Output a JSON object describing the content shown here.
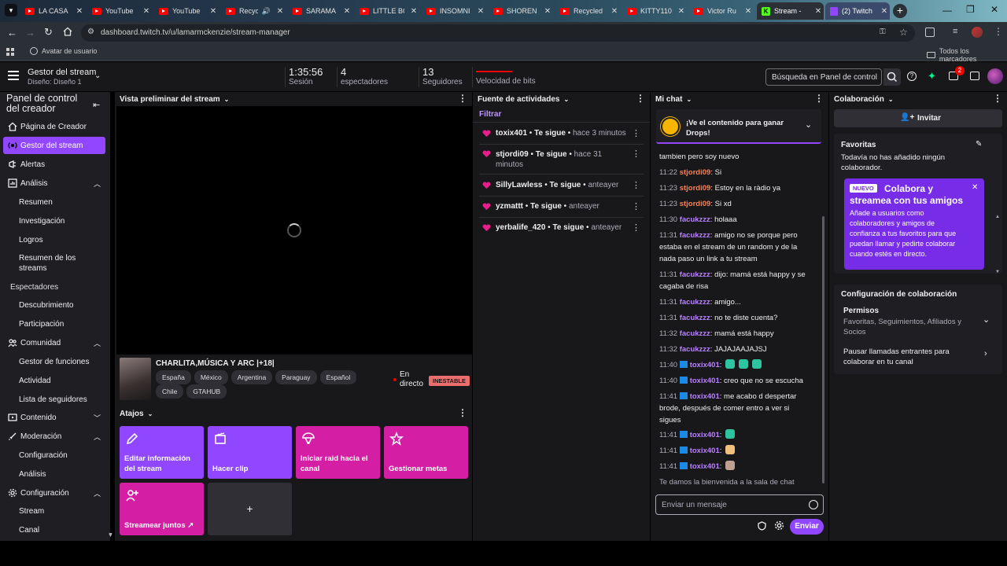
{
  "browser": {
    "tabs": [
      {
        "label": "LA CASA D"
      },
      {
        "label": "YouTube"
      },
      {
        "label": "YouTube"
      },
      {
        "label": "Recycl"
      },
      {
        "label": "SARAMA"
      },
      {
        "label": "LITTLE BO"
      },
      {
        "label": "INSOMNI"
      },
      {
        "label": "SHOREN"
      },
      {
        "label": "Recycled"
      },
      {
        "label": "KITTY110"
      },
      {
        "label": "Victor Ru"
      },
      {
        "label": "Stream - "
      },
      {
        "label": "(2) Twitch"
      }
    ],
    "url": "dashboard.twitch.tv/u/lamarmckenzie/stream-manager",
    "bookmark_left": "Avatar de usuario",
    "bookmark_right": "Todos los marcadores"
  },
  "topnav": {
    "title": "Gestor del stream",
    "subtitle": "Diseño: Diseño 1",
    "stats": [
      {
        "value": "1:35:56",
        "label": "Sesión"
      },
      {
        "value": "4",
        "label": "espectadores"
      },
      {
        "value": "13",
        "label": "Seguidores"
      },
      {
        "value": "",
        "label": "Velocidad de bits"
      }
    ],
    "search_placeholder": "Búsqueda en Panel de control",
    "notif_count": "2"
  },
  "sidebar": {
    "title": "Panel de control del creador",
    "items": [
      {
        "label": "Página de Creador"
      },
      {
        "label": "Gestor del stream"
      },
      {
        "label": "Alertas"
      },
      {
        "label": "Análisis"
      },
      {
        "label": "Resumen"
      },
      {
        "label": "Investigación"
      },
      {
        "label": "Logros"
      },
      {
        "label": "Resumen de los streams"
      },
      {
        "label": "Espectadores"
      },
      {
        "label": "Descubrimiento"
      },
      {
        "label": "Participación"
      },
      {
        "label": "Comunidad"
      },
      {
        "label": "Gestor de funciones"
      },
      {
        "label": "Actividad"
      },
      {
        "label": "Lista de seguidores"
      },
      {
        "label": "Contenido"
      },
      {
        "label": "Moderación"
      },
      {
        "label": "Configuración"
      },
      {
        "label": "Análisis"
      },
      {
        "label": "Configuración"
      },
      {
        "label": "Stream"
      },
      {
        "label": "Canal"
      }
    ]
  },
  "preview": {
    "header": "Vista preliminar del stream",
    "stream_title": "CHARLITA,MÚSICA Y ARC |+18|",
    "tags": [
      "España",
      "México",
      "Argentina",
      "Paraguay",
      "Español",
      "Chile",
      "GTAHUB"
    ],
    "live_label_1": "En",
    "live_label_2": "directo",
    "status_badge": "INESTABLE"
  },
  "shortcuts": {
    "header": "Atajos",
    "tiles": [
      {
        "label_1": "Editar información",
        "label_2": "del stream",
        "color": "#9147ff"
      },
      {
        "label_1": "Hacer clip",
        "label_2": "",
        "color": "#9147ff"
      },
      {
        "label_1": "Iniciar raid hacia el",
        "label_2": "canal",
        "color": "#d41fa4"
      },
      {
        "label_1": "Gestionar metas",
        "label_2": "",
        "color": "#d41fa4"
      },
      {
        "label_1": "Streamear juntos ↗",
        "label_2": "",
        "color": "#d41fa4"
      }
    ],
    "add_label": "+"
  },
  "activity": {
    "header": "Fuente de actividades",
    "filter": "Filtrar",
    "items": [
      {
        "user": "toxix401",
        "action": "Te sigue",
        "time": "hace 3 minutos"
      },
      {
        "user": "stjordi09",
        "action": "Te sigue",
        "time": "hace 31"
      },
      {
        "user": "SillyLawless",
        "action": "Te sigue",
        "time": "anteayer"
      },
      {
        "user": "yzmattt",
        "action": "Te sigue",
        "time": "anteayer"
      },
      {
        "user": "yerbalife_420",
        "action": "Te sigue",
        "time": "anteayer"
      }
    ],
    "wrap_extra": "minutos"
  },
  "chat": {
    "header": "Mi chat",
    "drops_1": "¡Ve el contenido para ganar",
    "drops_2": "Drops!",
    "messages": [
      {
        "time": "",
        "user": "",
        "text": "tambien pero soy nuevo"
      },
      {
        "time": "11:22",
        "user": "stjordi09",
        "text": ": Si"
      },
      {
        "time": "11:23",
        "user": "stjordi09",
        "text": ": Estoy en la ràdio ya"
      },
      {
        "time": "11:23",
        "user": "stjordi09",
        "text": ": Si xd"
      },
      {
        "time": "11:30",
        "user": "facukzzz",
        "text": ": holaaa"
      },
      {
        "time": "11:31",
        "user": "facukzzz",
        "text": ": amigo no se porque pero"
      },
      {
        "time": "",
        "user": "",
        "text": "estaba en el stream de un random y de la"
      },
      {
        "time": "",
        "user": "",
        "text": "nada paso un link a tu stream"
      },
      {
        "time": "11:31",
        "user": "facukzzz",
        "text": ": dijo: mamá está happy y se"
      },
      {
        "time": "",
        "user": "",
        "text": "cagaba de risa"
      },
      {
        "time": "11:31",
        "user": "facukzzz",
        "text": ": amigo..."
      },
      {
        "time": "11:31",
        "user": "facukzzz",
        "text": ": no te diste cuenta?"
      },
      {
        "time": "11:32",
        "user": "facukzzz",
        "text": ": mamá está happy"
      },
      {
        "time": "11:32",
        "user": "facukzzz",
        "text": ": JAJAJAAJAJSJ"
      },
      {
        "time": "11:40",
        "user": "toxix401",
        "text": ":"
      },
      {
        "time": "11:40",
        "user": "toxix401",
        "text": ": creo que no se escucha"
      },
      {
        "time": "11:41",
        "user": "toxix401",
        "text": ": me acabo d despertar"
      },
      {
        "time": "",
        "user": "",
        "text": "brode, después de comer entro a ver si"
      },
      {
        "time": "",
        "user": "",
        "text": "sigues"
      },
      {
        "time": "11:41",
        "user": "toxix401",
        "text": ":"
      },
      {
        "time": "11:41",
        "user": "toxix401",
        "text": ":"
      },
      {
        "time": "11:41",
        "user": "toxix401",
        "text": ":"
      },
      {
        "time": "",
        "user": "",
        "text": "Te damos la bienvenida a la sala de chat"
      }
    ],
    "input_placeholder": "Enviar un mensaje",
    "send_label": "Enviar"
  },
  "collab": {
    "header": "Colaboración",
    "invite": "Invitar",
    "fav_title": "Favoritas",
    "fav_desc_1": "Todavía no has añadido ningún",
    "fav_desc_2": "colaborador.",
    "promo_badge": "NUEVO",
    "promo_title_1": "Colabora y",
    "promo_title_2": "streamea con tus amigos",
    "promo_text": [
      "Añade a usuarios como",
      "colaboradores y amigos de",
      "confianza a tus favoritos para que",
      "puedan llamar y pedirte colaborar",
      "cuando estés en directo."
    ],
    "config_title": "Configuración de colaboración",
    "perm_title": "Permisos",
    "perm_desc_1": "Favoritas, Seguimientos, Afiliados y",
    "perm_desc_2": "Socios",
    "pause_1": "Pausar llamadas entrantes para",
    "pause_2": "colaborar en tu canal"
  },
  "colors": {
    "accent": "#9147ff",
    "magenta": "#d41fa4",
    "live": "#eb0400",
    "heart": "#e91e8c"
  }
}
